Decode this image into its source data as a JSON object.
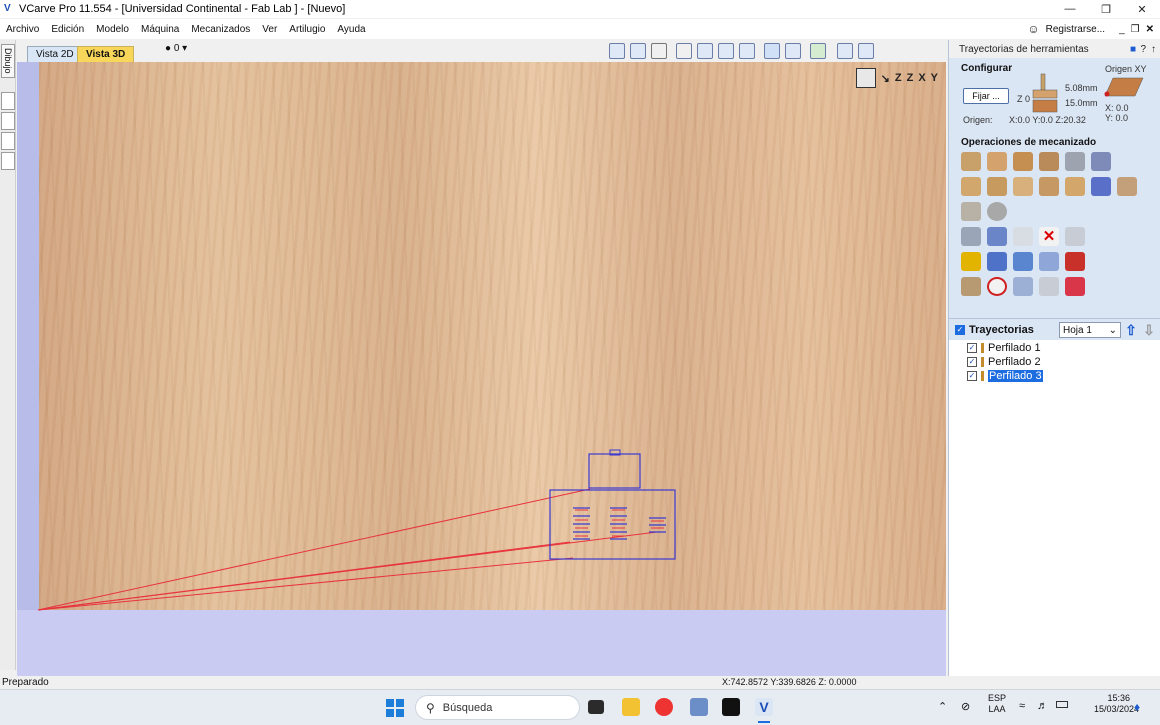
{
  "app": {
    "title": "VCarve Pro 11.554 - [Universidad Continental - Fab Lab ] - [Nuevo]"
  },
  "window": {
    "minimize": "—",
    "restore": "❐",
    "close": "✕"
  },
  "menu": {
    "items": [
      "Archivo",
      "Edición",
      "Modelo",
      "Máquina",
      "Mecanizados",
      "Ver",
      "Artilugio",
      "Ayuda"
    ],
    "register": "Registrarse..."
  },
  "left_strip": {
    "tab_label": "Dibujo"
  },
  "view": {
    "tab_2d": "Vista 2D",
    "tab_3d": "Vista 3D",
    "layer_selector": "0",
    "axes": [
      "Z",
      "Z",
      "X",
      "Y"
    ]
  },
  "panel": {
    "title": "Trayectorias de herramientas",
    "configurar": "Configurar",
    "origen_xy": "Origen XY",
    "fijar": "Fijar ...",
    "z0": "Z 0",
    "thickness_top": "5.08mm",
    "thickness_bottom": "15.0mm",
    "origen_label": "Origen:",
    "origen_value": "X:0.0 Y:0.0 Z:20.32",
    "x_val": "X: 0.0",
    "y_val": "Y: 0.0",
    "operaciones": "Operaciones de mecanizado",
    "trayectorias": "Trayectorias",
    "hoja": "Hoja 1",
    "toolpaths": [
      {
        "name": "Perfilado 1",
        "selected": false
      },
      {
        "name": "Perfilado 2",
        "selected": false
      },
      {
        "name": "Perfilado 3",
        "selected": true
      }
    ]
  },
  "status": {
    "left": "Preparado",
    "coords": "X:742.8572 Y:339.6826 Z:  0.0000"
  },
  "taskbar": {
    "search": "Búsqueda",
    "lang_top": "ESP",
    "lang_bottom": "LAA",
    "time": "15:36",
    "date": "15/03/2024"
  },
  "colors": {
    "toolpath_red": "#e8323c",
    "vector_blue": "#3a3ad0",
    "accent_blue": "#1d6ce0",
    "tab_yellow": "#f7d65a"
  }
}
